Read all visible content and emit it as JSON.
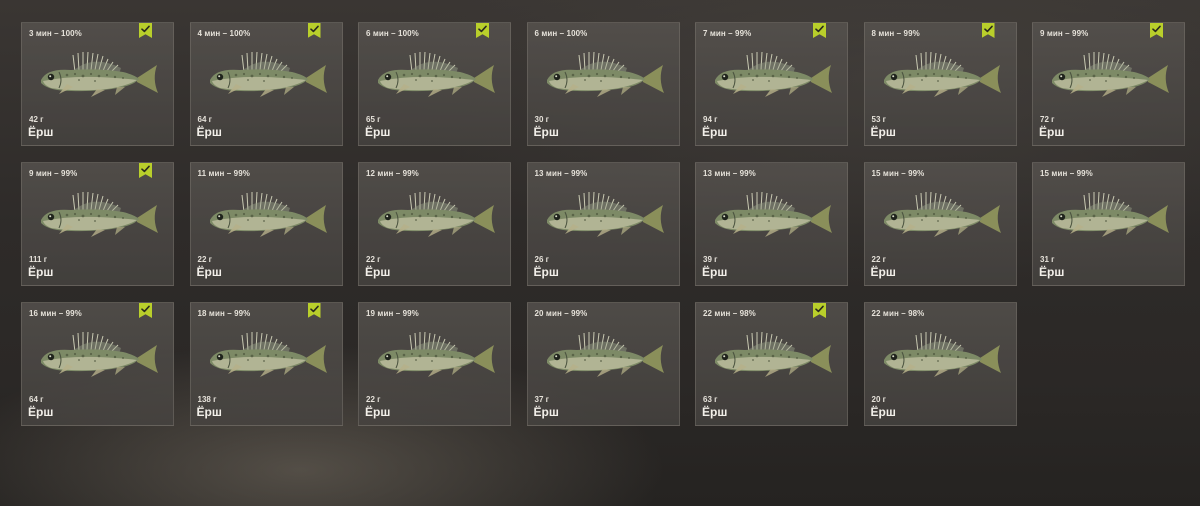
{
  "catch_list": {
    "accent_color": "#b9cf2b",
    "fish_icon": "ruffe-fish-icon",
    "check_icon": "check-icon",
    "items": [
      {
        "duration": "3 мин – 100%",
        "weight": "42 г",
        "name": "Ёрш",
        "marked": true
      },
      {
        "duration": "4 мин – 100%",
        "weight": "64 г",
        "name": "Ёрш",
        "marked": true
      },
      {
        "duration": "6 мин – 100%",
        "weight": "65 г",
        "name": "Ёрш",
        "marked": true
      },
      {
        "duration": "6 мин – 100%",
        "weight": "30 г",
        "name": "Ёрш",
        "marked": false
      },
      {
        "duration": "7 мин – 99%",
        "weight": "94 г",
        "name": "Ёрш",
        "marked": true
      },
      {
        "duration": "8 мин – 99%",
        "weight": "53 г",
        "name": "Ёрш",
        "marked": true
      },
      {
        "duration": "9 мин – 99%",
        "weight": "72 г",
        "name": "Ёрш",
        "marked": true
      },
      {
        "duration": "9 мин – 99%",
        "weight": "111 г",
        "name": "Ёрш",
        "marked": true
      },
      {
        "duration": "11 мин – 99%",
        "weight": "22 г",
        "name": "Ёрш",
        "marked": false
      },
      {
        "duration": "12 мин – 99%",
        "weight": "22 г",
        "name": "Ёрш",
        "marked": false
      },
      {
        "duration": "13 мин – 99%",
        "weight": "26 г",
        "name": "Ёрш",
        "marked": false
      },
      {
        "duration": "13 мин – 99%",
        "weight": "39 г",
        "name": "Ёрш",
        "marked": false
      },
      {
        "duration": "15 мин – 99%",
        "weight": "22 г",
        "name": "Ёрш",
        "marked": false
      },
      {
        "duration": "15 мин – 99%",
        "weight": "31 г",
        "name": "Ёрш",
        "marked": false
      },
      {
        "duration": "16 мин – 99%",
        "weight": "64 г",
        "name": "Ёрш",
        "marked": true
      },
      {
        "duration": "18 мин – 99%",
        "weight": "138 г",
        "name": "Ёрш",
        "marked": true
      },
      {
        "duration": "19 мин – 99%",
        "weight": "22 г",
        "name": "Ёрш",
        "marked": false
      },
      {
        "duration": "20 мин – 99%",
        "weight": "37 г",
        "name": "Ёрш",
        "marked": false
      },
      {
        "duration": "22 мин – 98%",
        "weight": "63 г",
        "name": "Ёрш",
        "marked": true
      },
      {
        "duration": "22 мин – 98%",
        "weight": "20 г",
        "name": "Ёрш",
        "marked": false
      }
    ]
  }
}
